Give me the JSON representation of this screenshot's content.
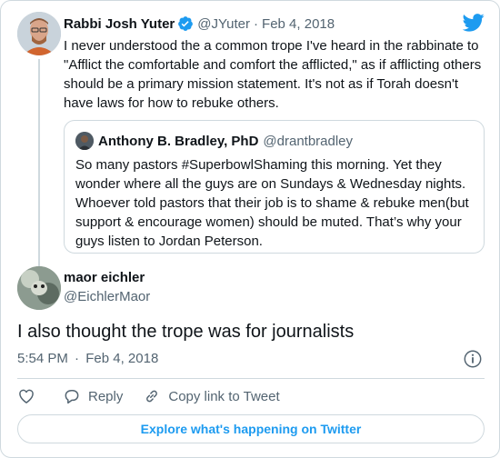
{
  "parent_tweet": {
    "author_name": "Rabbi Josh Yuter",
    "handle": "@JYuter",
    "separator": "·",
    "date": "Feb 4, 2018",
    "text": "I never understood the a common trope I've heard in the rabbinate to \"Afflict the comfortable and comfort the afflicted,\" as if afflicting others should be a primary mission statement. It's not as if Torah doesn't have laws for how to rebuke others."
  },
  "quoted_tweet": {
    "author_name": "Anthony B. Bradley, PhD",
    "handle": "@drantbradley",
    "text": "So many pastors #SuperbowlShaming this morning. Yet they wonder where all the guys are on Sundays & Wednesday nights. Whoever told pastors that their job is to shame & rebuke men(but support & encourage women) should be muted. That’s why your guys listen to Jordan Peterson."
  },
  "main_tweet": {
    "author_name": "maor eichler",
    "handle": "@EichlerMaor",
    "text": "I also thought the trope was for journalists",
    "time": "5:54 PM",
    "separator": "·",
    "date": "Feb 4, 2018"
  },
  "actions": {
    "reply_label": "Reply",
    "copy_link_label": "Copy link to Tweet"
  },
  "footer": {
    "explore_label": "Explore what's happening on Twitter"
  },
  "icons": {
    "brand": "twitter-bird-icon",
    "verified": "verified-badge-icon",
    "info": "info-icon",
    "like": "heart-icon",
    "reply": "reply-icon",
    "copy_link": "link-icon"
  },
  "colors": {
    "accent": "#1d9bf0",
    "text": "#0f1419",
    "muted": "#536471",
    "border": "#cfd9de"
  }
}
